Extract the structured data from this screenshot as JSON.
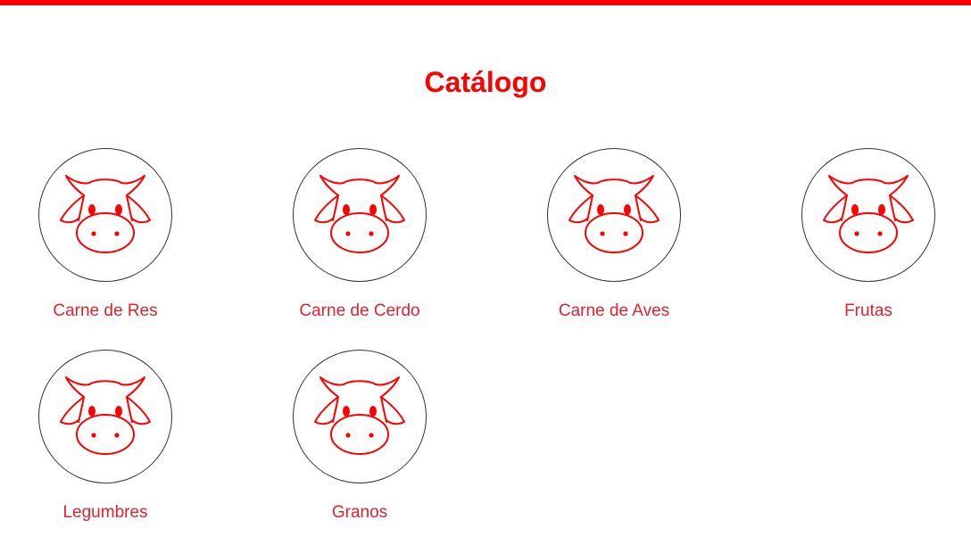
{
  "page": {
    "title": "Catálogo",
    "accent_color": "#ff0000",
    "label_color": "#e0222e"
  },
  "catalog": {
    "items": [
      {
        "label": "Carne de Res",
        "icon": "cow-icon"
      },
      {
        "label": "Carne de Cerdo",
        "icon": "cow-icon"
      },
      {
        "label": "Carne de Aves",
        "icon": "cow-icon"
      },
      {
        "label": "Frutas",
        "icon": "cow-icon"
      },
      {
        "label": "Legumbres",
        "icon": "cow-icon"
      },
      {
        "label": "Granos",
        "icon": "cow-icon"
      }
    ]
  }
}
